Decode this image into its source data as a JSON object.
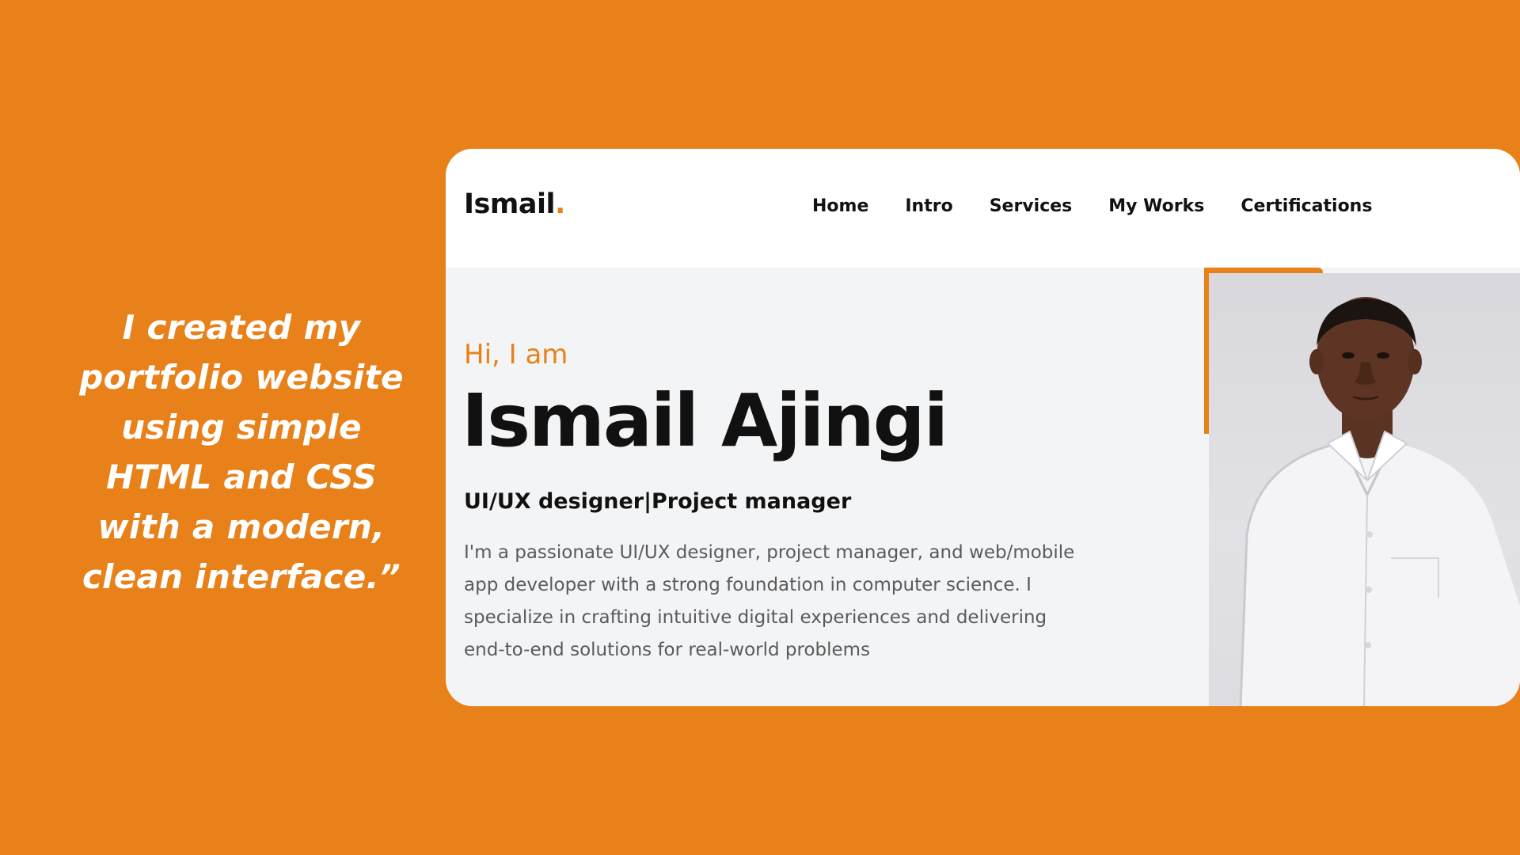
{
  "colors": {
    "background": "#E8811A",
    "accent": "#E8811A",
    "text": "#111111",
    "muted_text": "#5a5a5a",
    "hero_background": "#F3F4F6"
  },
  "quote": {
    "lines": [
      "I created my",
      "portfolio website",
      "using simple",
      "HTML and CSS",
      "with a modern,",
      "clean interface.”"
    ]
  },
  "site": {
    "brand": {
      "name": "Ismail",
      "dot": "."
    },
    "nav": {
      "items": [
        "Home",
        "Intro",
        "Services",
        "My Works",
        "Certifications"
      ]
    },
    "hero": {
      "greeting": "Hi, I am",
      "name": "Ismail Ajingi",
      "role": "UI/UX designer|Project manager",
      "bio": "I'm a passionate UI/UX designer, project manager, and web/mobile app developer with a strong foundation in computer science. I specialize in crafting intuitive digital experiences and delivering end-to-end solutions for real-world problems",
      "photo_icon": "portrait-photo"
    }
  }
}
